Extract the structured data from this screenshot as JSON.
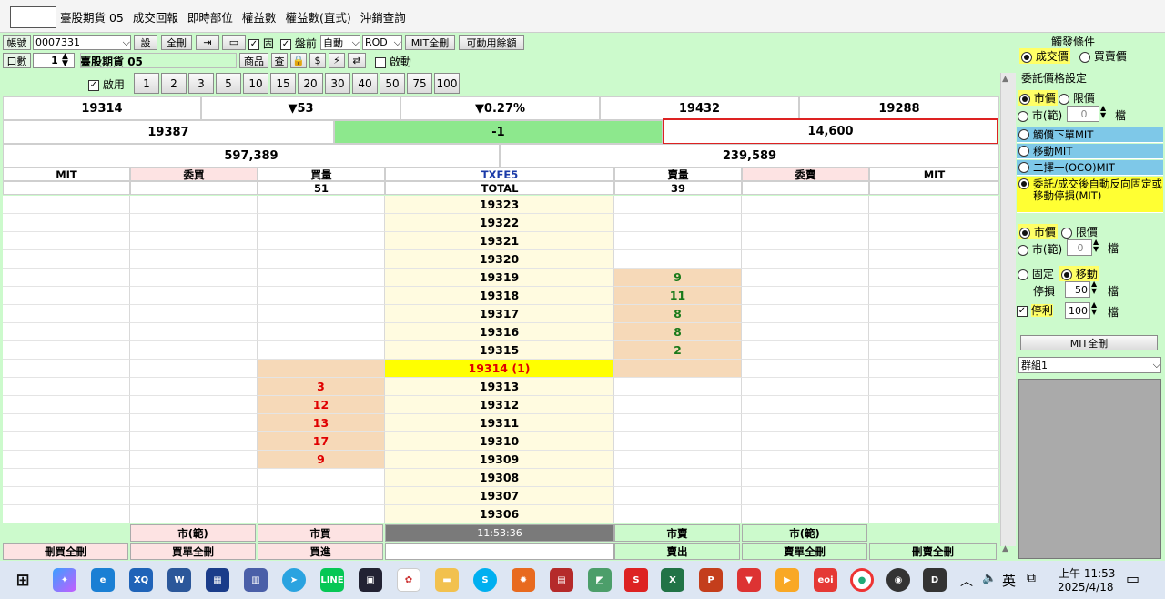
{
  "menu": {
    "items": [
      "臺股期貨 05",
      "成交回報",
      "即時部位",
      "權益數",
      "權益數(直式)",
      "沖銷查詢"
    ]
  },
  "toolbar": {
    "account_label": "帳號",
    "account_value": "0007331",
    "set_btn": "設",
    "cancel_all_btn": "全刪",
    "fixed_label": "固",
    "preopen_label": "盤前",
    "auto_label": "自動",
    "rod_label": "ROD",
    "mit_cancel_all": "MIT全刪",
    "available_margin": "可動用餘額",
    "lots_label": "口數",
    "lots_value": "1",
    "product_name": "臺股期貨",
    "product_month": "05",
    "product_btn": "商品",
    "dollar": "$",
    "start_label": "啟動",
    "enable_label": "啟用",
    "quick_lots": [
      "1",
      "2",
      "3",
      "5",
      "10",
      "15",
      "20",
      "30",
      "40",
      "50",
      "75",
      "100"
    ]
  },
  "info": {
    "row1": [
      "19314",
      "▼53",
      "▼0.27%",
      "19432",
      "19288"
    ],
    "row2": [
      "19387",
      "-1",
      "14,600"
    ],
    "row3": [
      "597,389",
      "239,589"
    ]
  },
  "ladder_header": {
    "cols": [
      "MIT",
      "委買",
      "買量",
      "TXFE5",
      "賣量",
      "委賣",
      "MIT"
    ],
    "buy_total": "51",
    "total_label": "TOTAL",
    "sell_total": "39"
  },
  "ladder_rows": [
    {
      "price": "19323",
      "bid": "",
      "ask": ""
    },
    {
      "price": "19322",
      "bid": "",
      "ask": ""
    },
    {
      "price": "19321",
      "bid": "",
      "ask": ""
    },
    {
      "price": "19320",
      "bid": "",
      "ask": ""
    },
    {
      "price": "19319",
      "bid": "",
      "ask": "9"
    },
    {
      "price": "19318",
      "bid": "",
      "ask": "11"
    },
    {
      "price": "19317",
      "bid": "",
      "ask": "8"
    },
    {
      "price": "19316",
      "bid": "",
      "ask": "8"
    },
    {
      "price": "19315",
      "bid": "",
      "ask": "2"
    },
    {
      "price": "19314 (1)",
      "bid": "",
      "ask": "",
      "current": true
    },
    {
      "price": "19313",
      "bid": "3",
      "ask": ""
    },
    {
      "price": "19312",
      "bid": "12",
      "ask": ""
    },
    {
      "price": "19311",
      "bid": "13",
      "ask": ""
    },
    {
      "price": "19310",
      "bid": "17",
      "ask": ""
    },
    {
      "price": "19309",
      "bid": "9",
      "ask": ""
    },
    {
      "price": "19308",
      "bid": "",
      "ask": ""
    },
    {
      "price": "19307",
      "bid": "",
      "ask": ""
    },
    {
      "price": "19306",
      "bid": "",
      "ask": ""
    }
  ],
  "bottom": {
    "row1": [
      "市(範)",
      "市買",
      "11:53:36",
      "市賣",
      "市(範)"
    ],
    "row2": [
      "刪買全刪",
      "買單全刪",
      "買進",
      "賣出",
      "賣單全刪",
      "刪賣全刪"
    ]
  },
  "side": {
    "trigger_title": "觸發條件",
    "trigger_opts": [
      "成交價",
      "買賣價"
    ],
    "price_title": "委託價格設定",
    "price_opts": [
      "市價",
      "限價",
      "市(範)"
    ],
    "range_value": "0",
    "tick_unit": "檔",
    "mit_opts": [
      "觸價下單MIT",
      "移動MIT",
      "二擇一(OCO)MIT"
    ],
    "auto_reverse": "委託/成交後自動反向固定或移動停損(MIT)",
    "price2_opts": [
      "市價",
      "限價",
      "市(範)"
    ],
    "range2_value": "0",
    "stop_opts": [
      "固定",
      "移動"
    ],
    "stop_loss_label": "停損",
    "stop_loss_value": "50",
    "take_profit_label": "停利",
    "take_profit_value": "100",
    "mit_cancel_all": "MIT全刪",
    "group": "群組1"
  },
  "taskbar": {
    "time": "上午 11:53",
    "date": "2025/4/18",
    "ime": "英"
  },
  "colors": {
    "panel": "#ccfacc",
    "price_col": "#fffbe0",
    "current": "#ffff00",
    "bid_fill": "#f6d9b8",
    "red": "#e00000",
    "green": "#1a7a1a"
  }
}
